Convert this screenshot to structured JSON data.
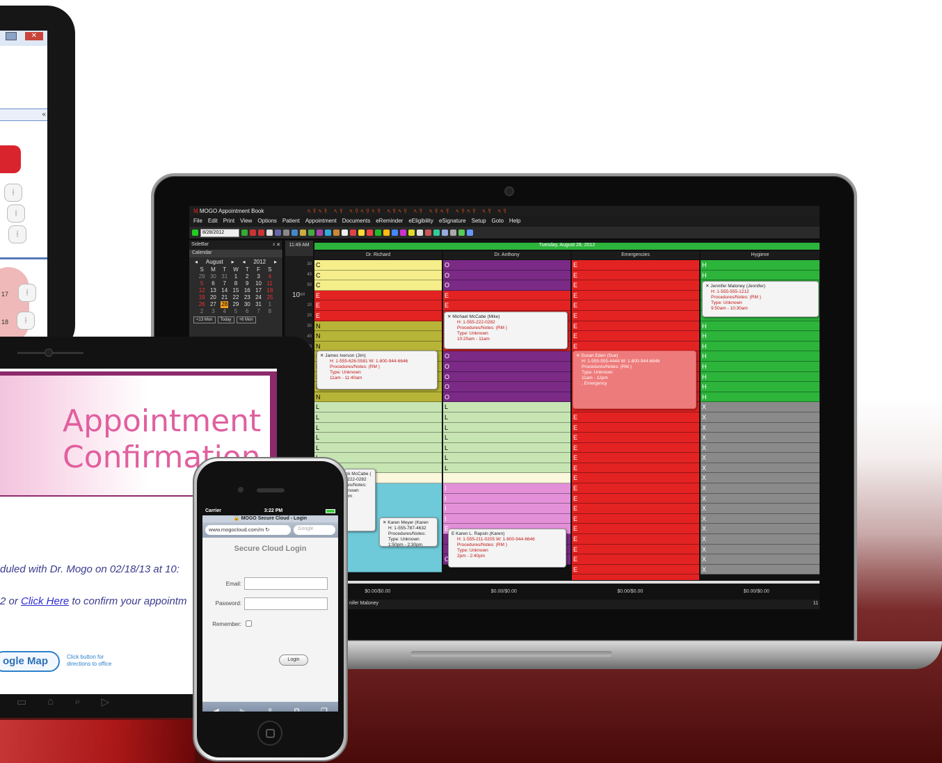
{
  "laptop_app": {
    "window_title": "MOGO Appointment Book",
    "menu": [
      "File",
      "Edit",
      "Print",
      "View",
      "Options",
      "Patient",
      "Appointment",
      "Documents",
      "eReminder",
      "eEligibility",
      "eSignature",
      "Setup",
      "Goto",
      "Help"
    ],
    "toolbar_date": "8/28/2012",
    "sidebar": {
      "header": "SideBar",
      "calendar_label": "Calendar",
      "month": "August",
      "year": "2012",
      "weekdays": [
        "S",
        "M",
        "T",
        "W",
        "T",
        "F",
        "S"
      ],
      "weeks": [
        [
          "29",
          "30",
          "31",
          "1",
          "2",
          "3",
          "4"
        ],
        [
          "5",
          "6",
          "7",
          "8",
          "9",
          "10",
          "11"
        ],
        [
          "12",
          "13",
          "14",
          "15",
          "16",
          "17",
          "18"
        ],
        [
          "19",
          "20",
          "21",
          "22",
          "23",
          "24",
          "25"
        ],
        [
          "26",
          "27",
          "28",
          "29",
          "30",
          "31",
          "1"
        ],
        [
          "2",
          "3",
          "4",
          "5",
          "6",
          "7",
          "8"
        ]
      ],
      "buttons": [
        "<13 Mon",
        "Today",
        "+6 Mon"
      ]
    },
    "current_time": "11:49 AM",
    "time_labels": {
      "h10": "10",
      "am": "AM",
      "minutes": [
        "30",
        "40",
        "50",
        "10",
        "20",
        "30",
        "40",
        "50"
      ]
    },
    "date_header": "Tuesday, August 28, 2012",
    "columns": [
      "Dr. Richard",
      "Dr. Anthony",
      "Emergencies",
      "Hygiene"
    ],
    "appointments": {
      "jennifer": {
        "name": "Jennifer Maloney (Jennifer)",
        "phone": "H: 1-555-555-1212",
        "notes": "Procedures/Notes: (RM )",
        "type": "Type: Unknown",
        "time": "9:50am  - 10:30am"
      },
      "michael": {
        "name": "Michael McCabe (Mike)",
        "phone": "H: 1-555-222-0282",
        "notes": "Procedures/Notes: (RM )",
        "type": "Type: Unknown",
        "time": "10:20am  - 11am"
      },
      "james": {
        "name": "James Iverson (Jim)",
        "phone": "H: 1-555-626-5581 W: 1-800-944-6646",
        "notes": "Procedures/Notes: (RM )",
        "type": "Type: Unknown",
        "time": "11am  - 11:40am"
      },
      "susan": {
        "name": "Susan Eden (Sue)",
        "phone": "H: 1-555-555-4444 W: 1-800-944-6646",
        "notes": "Procedures/Notes: (RM )",
        "type": "Type: Unknown",
        "time": "11am  - 12pm",
        "extra": ", Emergency"
      },
      "mccabe2": {
        "name": "ck McCabe (",
        "phone": "-222-0282",
        "notes": "res/Notes:",
        "type": "known",
        "time": "pm"
      },
      "karenm": {
        "name": "Karen Meyer (Karen",
        "phone": "H: 1-555-787-4632",
        "notes": "Procedures/Notes:",
        "type": "Type: Unknown",
        "time": "1:50pm  - 2:30pm"
      },
      "karenr": {
        "name": "Karen L. Rapsin (Karen)",
        "phone": "H: 1-555-211-0205 W: 1-800-944-6646",
        "notes": "Procedures/Notes: (RM )",
        "type": "Type: Unknown",
        "time": "2pm  - 2:40pm"
      }
    },
    "totals": [
      "$0.00/$0.00",
      "$0.00/$0.00",
      "$0.00/$0.00",
      "$0.00/$0.00"
    ],
    "status_name": "nifer Maloney",
    "status_right": "11"
  },
  "confirmation": {
    "title_line1": "Appointment",
    "title_line2": "Confirmation",
    "line1": "duled with Dr. Mogo on 02/18/13 at 10:",
    "line2_prefix": "2 or ",
    "line2_link": "Click Here",
    "line2_suffix": " to confirm your appointm",
    "map_button": "ogle Map",
    "map_note": "Click button for directions to office"
  },
  "phone": {
    "carrier": "Carrier",
    "time": "3:22 PM",
    "page_title": "MOGO Secure Cloud - Login",
    "url": "www.mogocloud.com/m",
    "search_placeholder": "Google",
    "heading": "Secure Cloud Login",
    "email_label": "Email:",
    "password_label": "Password:",
    "remember_label": "Remember:",
    "login_button": "Login"
  },
  "tablet_top": {
    "teeth": [
      "17",
      "18"
    ]
  },
  "colors": {
    "green": "#2cb43b",
    "red": "#e32222",
    "purple": "#7b2a86",
    "yellow": "#f5ee8a",
    "olive": "#b8b438",
    "lightgreen": "#c7e5b3",
    "cyan": "#6ec9d9",
    "gray": "#8a8a8a",
    "magenta_brand": "#e0609f"
  }
}
